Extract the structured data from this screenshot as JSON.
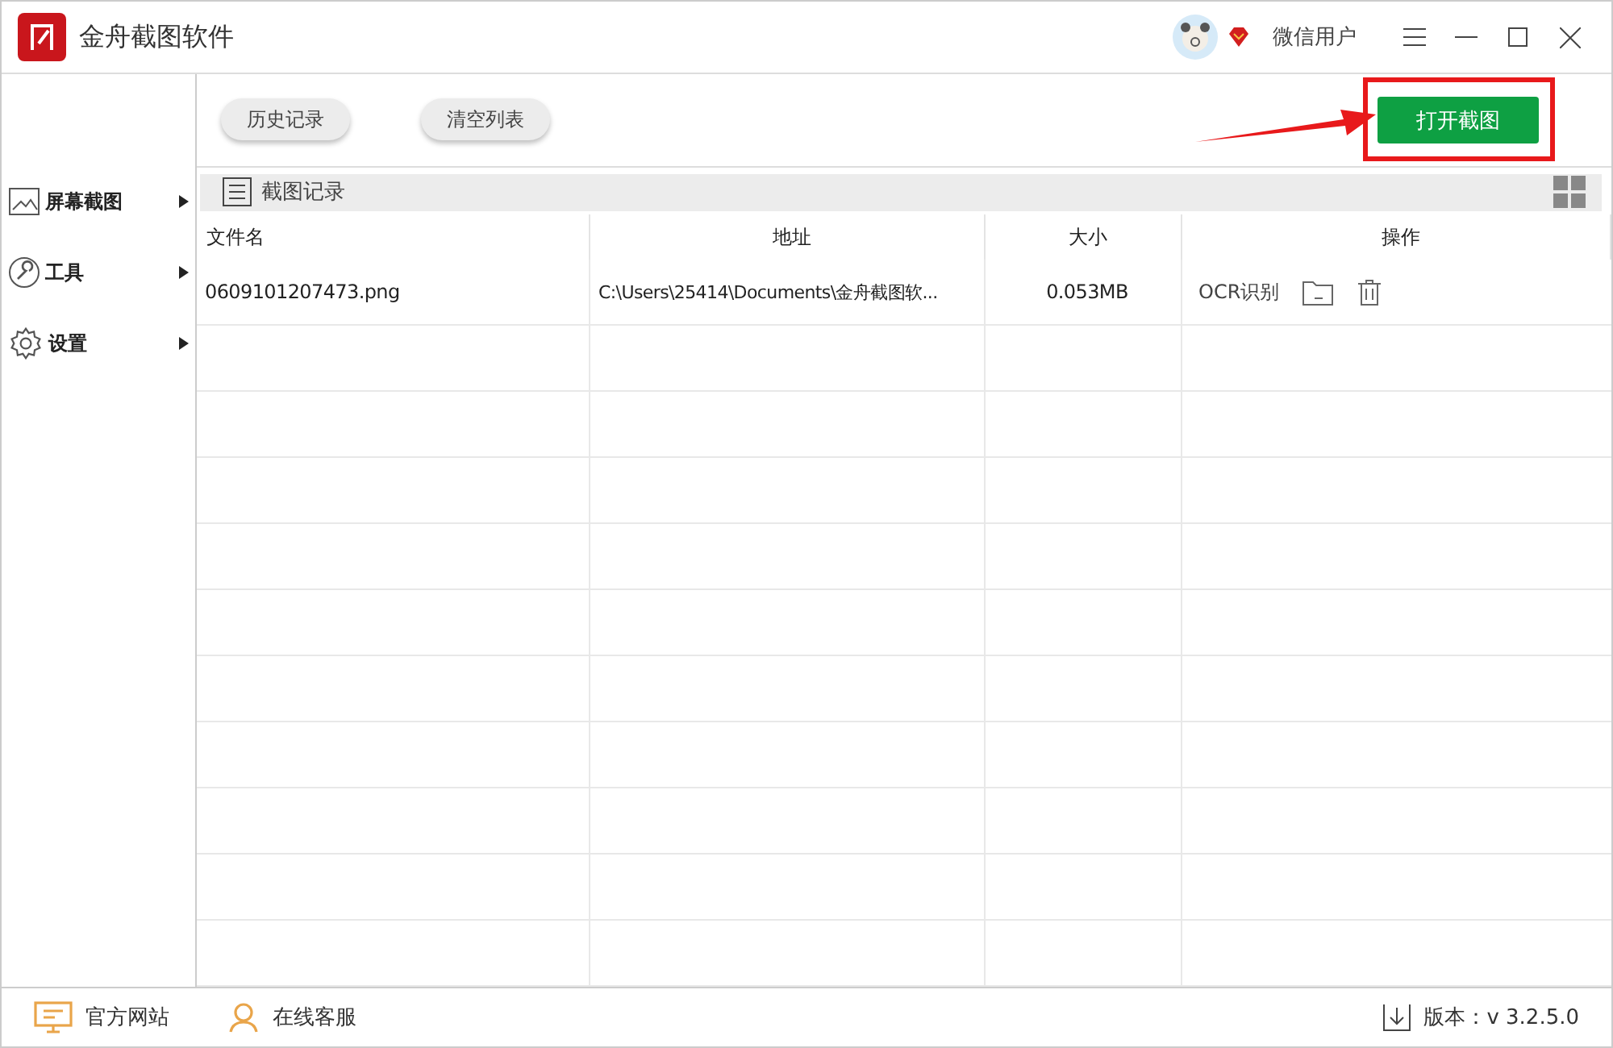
{
  "window": {
    "title": "金舟截图软件",
    "user": "微信用户"
  },
  "toolbar": {
    "buttons": [
      "历史记录",
      "清空列表"
    ],
    "primary": "打开截图"
  },
  "sidebar": {
    "items": [
      {
        "label": "屏幕截图",
        "kind": "image"
      },
      {
        "label": "工具",
        "kind": "wrench"
      },
      {
        "label": "设置",
        "kind": "gear"
      }
    ]
  },
  "section": {
    "title": "截图记录"
  },
  "table": {
    "columns": [
      "文件名",
      "地址",
      "大小",
      "操作"
    ],
    "rows": [
      {
        "file": "0609101207473.png",
        "path": "C:\\Users\\25414\\Documents\\金舟截图软...",
        "size": "0.053MB",
        "action": "OCR识别"
      }
    ]
  },
  "status_bar": {
    "links": [
      {
        "label": "官方网站",
        "kind": "monitor"
      },
      {
        "label": "在线客服",
        "kind": "person"
      }
    ],
    "version": "版本：v 3.2.5.0"
  }
}
